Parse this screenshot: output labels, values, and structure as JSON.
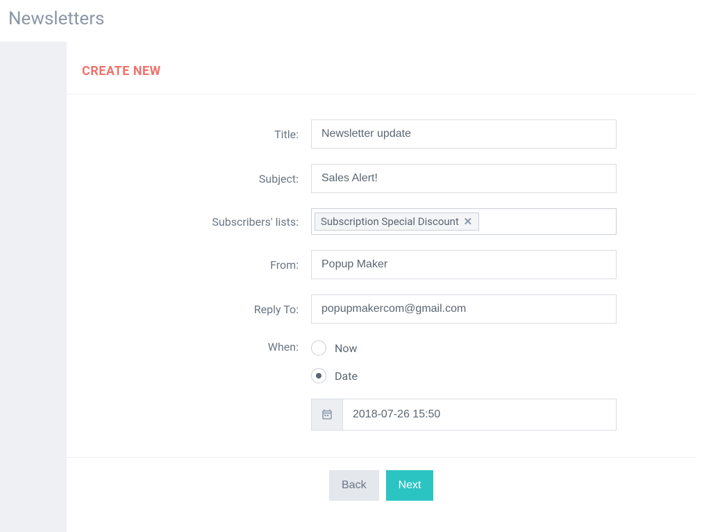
{
  "page": {
    "title": "Newsletters"
  },
  "card": {
    "heading": "CREATE NEW"
  },
  "form": {
    "title_label": "Title:",
    "title_value": "Newsletter update",
    "subject_label": "Subject:",
    "subject_value": "Sales Alert!",
    "subscribers_label": "Subscribers' lists:",
    "subscribers_tag": "Subscription Special Discount",
    "from_label": "From:",
    "from_value": "Popup Maker",
    "reply_to_label": "Reply To:",
    "reply_to_value": "popupmakercom@gmail.com",
    "when_label": "When:",
    "when_options": {
      "now": "Now",
      "date": "Date"
    },
    "when_selected": "date",
    "date_value": "2018-07-26 15:50"
  },
  "buttons": {
    "back": "Back",
    "next": "Next"
  }
}
